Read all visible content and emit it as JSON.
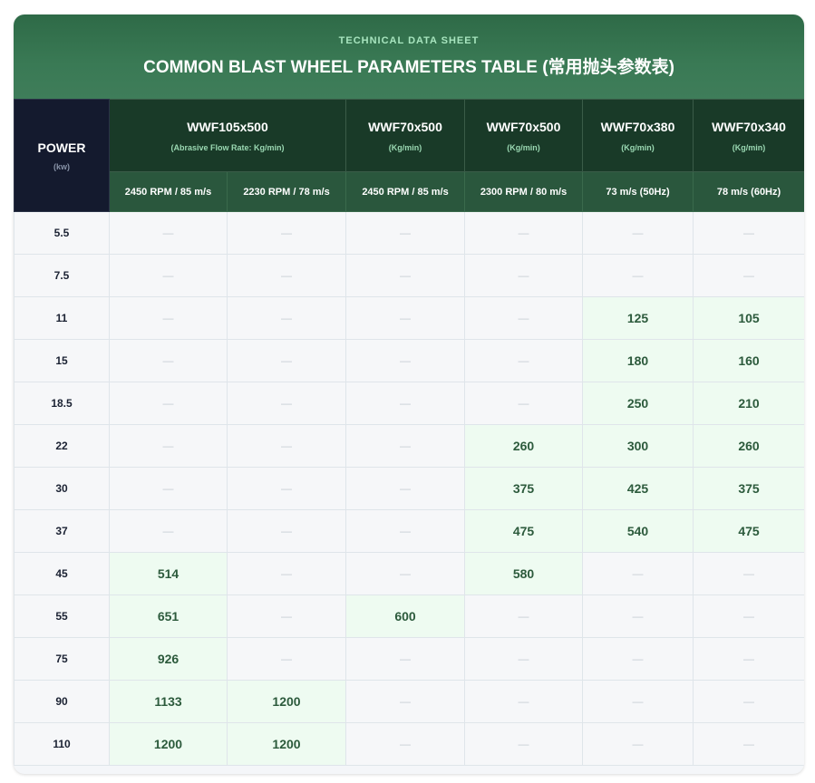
{
  "header": {
    "subtitle": "TECHNICAL DATA SHEET",
    "title": "COMMON BLAST WHEEL PARAMETERS TABLE (常用抛头参数表)"
  },
  "power_header": {
    "label": "POWER",
    "unit": "(kw)"
  },
  "models": [
    {
      "name": "WWF105x500",
      "unit": "(Abrasive Flow Rate: Kg/min)"
    },
    {
      "name": "WWF70x500",
      "unit": "(Kg/min)"
    },
    {
      "name": "WWF70x500",
      "unit": "(Kg/min)"
    },
    {
      "name": "WWF70x380",
      "unit": "(Kg/min)"
    },
    {
      "name": "WWF70x340",
      "unit": "(Kg/min)"
    }
  ],
  "speeds": [
    "2450 RPM / 85 m/s",
    "2230 RPM / 78 m/s",
    "2450 RPM / 85 m/s",
    "2300 RPM / 80 m/s",
    "73 m/s (50Hz)",
    "78 m/s (60Hz)"
  ],
  "rows": [
    {
      "power": "5.5",
      "values": [
        "—",
        "—",
        "—",
        "—",
        "—",
        "—"
      ]
    },
    {
      "power": "7.5",
      "values": [
        "—",
        "—",
        "—",
        "—",
        "—",
        "—"
      ]
    },
    {
      "power": "11",
      "values": [
        "—",
        "—",
        "—",
        "—",
        "125",
        "105"
      ]
    },
    {
      "power": "15",
      "values": [
        "—",
        "—",
        "—",
        "—",
        "180",
        "160"
      ]
    },
    {
      "power": "18.5",
      "values": [
        "—",
        "—",
        "—",
        "—",
        "250",
        "210"
      ]
    },
    {
      "power": "22",
      "values": [
        "—",
        "—",
        "—",
        "260",
        "300",
        "260"
      ]
    },
    {
      "power": "30",
      "values": [
        "—",
        "—",
        "—",
        "375",
        "425",
        "375"
      ]
    },
    {
      "power": "37",
      "values": [
        "—",
        "—",
        "—",
        "475",
        "540",
        "475"
      ]
    },
    {
      "power": "45",
      "values": [
        "514",
        "—",
        "—",
        "580",
        "—",
        "—"
      ]
    },
    {
      "power": "55",
      "values": [
        "651",
        "—",
        "600",
        "—",
        "—",
        "—"
      ]
    },
    {
      "power": "75",
      "values": [
        "926",
        "—",
        "—",
        "—",
        "—",
        "—"
      ]
    },
    {
      "power": "90",
      "values": [
        "1133",
        "1200",
        "—",
        "—",
        "—",
        "—"
      ]
    },
    {
      "power": "110",
      "values": [
        "1200",
        "1200",
        "—",
        "—",
        "—",
        "—"
      ]
    }
  ]
}
